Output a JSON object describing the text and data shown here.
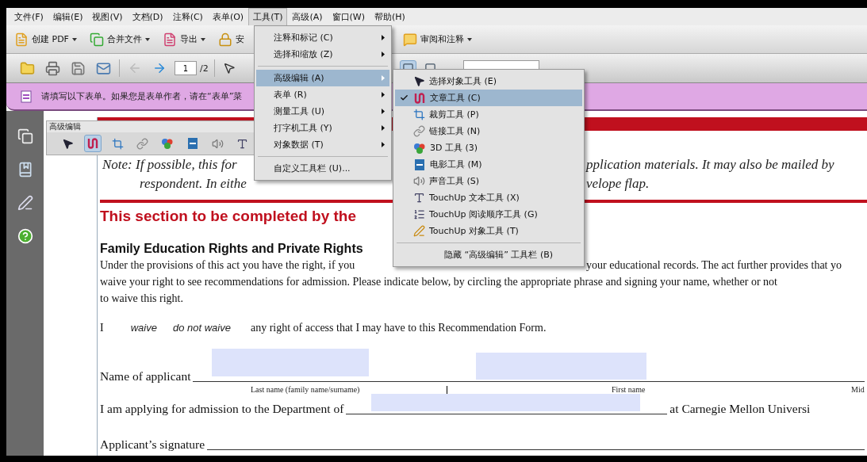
{
  "menubar": [
    {
      "label": "文件(F)",
      "selected": false
    },
    {
      "label": "编辑(E)",
      "selected": false
    },
    {
      "label": "视图(V)",
      "selected": false
    },
    {
      "label": "文档(D)",
      "selected": false
    },
    {
      "label": "注释(C)",
      "selected": false
    },
    {
      "label": "表单(O)",
      "selected": false
    },
    {
      "label": "工具(T)",
      "selected": true
    },
    {
      "label": "高级(A)",
      "selected": false
    },
    {
      "label": "窗口(W)",
      "selected": false
    },
    {
      "label": "帮助(H)",
      "selected": false
    }
  ],
  "toolbar": {
    "buttons": [
      {
        "label": "创建 PDF",
        "dropdown": true
      },
      {
        "label": "合并文件",
        "dropdown": true
      },
      {
        "label": "导出",
        "dropdown": true
      },
      {
        "label": "安",
        "dropdown": false
      },
      {
        "label": "审阅和注释",
        "dropdown": true
      }
    ]
  },
  "navigation": {
    "page_number": "1",
    "page_total": "/2"
  },
  "form_bar": {
    "message": "请填写以下表单。如果您是表单作者，请在“表单”菜"
  },
  "floating_toolbar": {
    "title": "高级编辑",
    "tools": [
      {
        "selected": false
      },
      {
        "selected": true
      },
      {
        "selected": false
      },
      {
        "selected": false
      },
      {
        "selected": false
      },
      {
        "selected": false
      },
      {
        "selected": false
      },
      {
        "selected": false
      }
    ]
  },
  "tools_menu": {
    "groups": [
      [
        {
          "label": "注释和标记 (C)",
          "submenu": true,
          "selected": false
        },
        {
          "label": "选择和缩放 (Z)",
          "submenu": true,
          "selected": false
        }
      ],
      [
        {
          "label": "高级编辑 (A)",
          "submenu": true,
          "selected": true
        },
        {
          "label": "表单 (R)",
          "submenu": true,
          "selected": false
        },
        {
          "label": "测量工具 (U)",
          "submenu": true,
          "selected": false
        },
        {
          "label": "打字机工具 (Y)",
          "submenu": true,
          "selected": false
        },
        {
          "label": "对象数据 (T)",
          "submenu": true,
          "selected": false
        }
      ],
      [
        {
          "label": "自定义工具栏 (U)...",
          "submenu": false,
          "selected": false
        }
      ]
    ]
  },
  "submenu": {
    "groups": [
      [
        {
          "label": "选择对象工具 (E)",
          "checked": false,
          "selected": false
        },
        {
          "label": "文章工具 (C)",
          "checked": true,
          "selected": true
        },
        {
          "label": "裁剪工具 (P)",
          "checked": false,
          "selected": false
        },
        {
          "label": "链接工具 (N)",
          "checked": false,
          "selected": false
        },
        {
          "label": "3D 工具 (3)",
          "checked": false,
          "selected": false
        },
        {
          "label": "电影工具 (M)",
          "checked": false,
          "selected": false
        },
        {
          "label": "声音工具 (S)",
          "checked": false,
          "selected": false
        },
        {
          "label": "TouchUp 文本工具 (X)",
          "checked": false,
          "selected": false
        },
        {
          "label": "TouchUp 阅读顺序工具 (G)",
          "checked": false,
          "selected": false
        },
        {
          "label": "TouchUp 对象工具 (T)",
          "checked": false,
          "selected": false
        }
      ],
      [
        {
          "label": "隐藏 “高级编辑” 工具栏 (B)",
          "checked": false,
          "selected": false
        }
      ]
    ]
  },
  "document": {
    "note_lines": [
      {
        "left": "Note:  If possible, this for",
        "right": "pplication materials. It may also be mailed by"
      },
      {
        "left": "respondent. In eithe",
        "right": "velope flap."
      }
    ],
    "section_heading": "This section to be completed by the",
    "subheading": "Family Education Rights and Private Rights",
    "paragraph_lines": [
      {
        "left": "Under the provisions of this act you have the right, if you",
        "right": "your educational records. The act further provides that yo"
      },
      {
        "left": "waive your right to see recommendations for admission. Please indicate below, by circling the appropriate phrase and signing your name, whether or not"
      },
      {
        "left": "to waive this right."
      }
    ],
    "waiver": {
      "subject": "I",
      "options": [
        "waive",
        "do not waive"
      ],
      "text": "any right of access that I may have to this Recommendation Form."
    },
    "name_row": {
      "label": "Name of applicant",
      "captions": [
        "Last name (family name/surname)",
        "First name",
        "Mid"
      ]
    },
    "department_row": {
      "label": "I am applying for admission to the Department of",
      "suffix": "at Carnegie Mellon Universi"
    },
    "signature_row": {
      "label": "Applicant’s signature"
    }
  }
}
